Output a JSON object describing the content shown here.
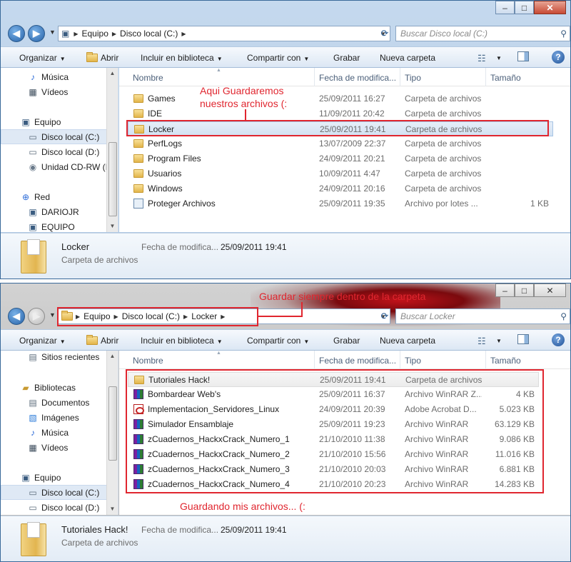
{
  "window1": {
    "controls": {
      "minimize": "–",
      "maximize": "□",
      "close": "✕"
    },
    "address": {
      "root_icon": "computer-icon",
      "segments": [
        "Equipo",
        "Disco local (C:)"
      ]
    },
    "search": {
      "placeholder": "Buscar Disco local (C:)"
    },
    "toolbar": {
      "organize": "Organizar",
      "open": "Abrir",
      "library": "Incluir en biblioteca",
      "share": "Compartir con",
      "burn": "Grabar",
      "new_folder": "Nueva carpeta"
    },
    "nav_items": [
      {
        "label": "Música",
        "icon": "music-icon"
      },
      {
        "label": "Vídeos",
        "icon": "video-icon"
      },
      {
        "label": "Equipo",
        "icon": "computer-icon"
      },
      {
        "label": "Disco local (C:)",
        "icon": "drive-icon",
        "selected": true
      },
      {
        "label": "Disco local (D:)",
        "icon": "drive-icon"
      },
      {
        "label": "Unidad CD-RW (I",
        "icon": "cd-icon"
      },
      {
        "label": "Red",
        "icon": "network-icon"
      },
      {
        "label": "DARIOJR",
        "icon": "computer-icon"
      },
      {
        "label": "EQUIPO",
        "icon": "computer-icon"
      }
    ],
    "columns": {
      "name": "Nombre",
      "date": "Fecha de modifica...",
      "type": "Tipo",
      "size": "Tamaño"
    },
    "files": [
      {
        "name": "Games",
        "date": "25/09/2011 16:27",
        "type": "Carpeta de archivos",
        "size": "",
        "icon": "folder"
      },
      {
        "name": "IDE",
        "date": "11/09/2011 20:42",
        "type": "Carpeta de archivos",
        "size": "",
        "icon": "folder"
      },
      {
        "name": "Locker",
        "date": "25/09/2011 19:41",
        "type": "Carpeta de archivos",
        "size": "",
        "icon": "folder",
        "highlighted": true
      },
      {
        "name": "PerfLogs",
        "date": "13/07/2009 22:37",
        "type": "Carpeta de archivos",
        "size": "",
        "icon": "folder"
      },
      {
        "name": "Program Files",
        "date": "24/09/2011 20:21",
        "type": "Carpeta de archivos",
        "size": "",
        "icon": "folder"
      },
      {
        "name": "Usuarios",
        "date": "10/09/2011 4:47",
        "type": "Carpeta de archivos",
        "size": "",
        "icon": "folder"
      },
      {
        "name": "Windows",
        "date": "24/09/2011 20:16",
        "type": "Carpeta de archivos",
        "size": "",
        "icon": "folder"
      },
      {
        "name": "Proteger Archivos",
        "date": "25/09/2011 19:35",
        "type": "Archivo por lotes ...",
        "size": "1 KB",
        "icon": "exe"
      }
    ],
    "details": {
      "name": "Locker",
      "type": "Carpeta de archivos",
      "date_label": "Fecha de modifica...",
      "date_value": "25/09/2011 19:41"
    },
    "annotation": "Aqui Guardaremos nuestros archivos (:"
  },
  "window2": {
    "controls": {
      "minimize": "–",
      "maximize": "□",
      "close": "✕"
    },
    "address": {
      "root_icon": "folder-icon",
      "segments": [
        "Equipo",
        "Disco local (C:)",
        "Locker"
      ]
    },
    "search": {
      "placeholder": "Buscar Locker"
    },
    "toolbar": {
      "organize": "Organizar",
      "open": "Abrir",
      "library": "Incluir en biblioteca",
      "share": "Compartir con",
      "burn": "Grabar",
      "new_folder": "Nueva carpeta"
    },
    "nav_items": [
      {
        "label": "Sitios recientes",
        "icon": "recent-icon"
      },
      {
        "label": "Bibliotecas",
        "icon": "library-icon"
      },
      {
        "label": "Documentos",
        "icon": "document-icon"
      },
      {
        "label": "Imágenes",
        "icon": "image-icon"
      },
      {
        "label": "Música",
        "icon": "music-icon"
      },
      {
        "label": "Vídeos",
        "icon": "video-icon"
      },
      {
        "label": "Equipo",
        "icon": "computer-icon"
      },
      {
        "label": "Disco local (C:)",
        "icon": "drive-icon",
        "selected": true
      },
      {
        "label": "Disco local (D:)",
        "icon": "drive-icon"
      }
    ],
    "columns": {
      "name": "Nombre",
      "date": "Fecha de modifica...",
      "type": "Tipo",
      "size": "Tamaño"
    },
    "files": [
      {
        "name": "Tutoriales Hack!",
        "date": "25/09/2011 19:41",
        "type": "Carpeta de archivos",
        "size": "",
        "icon": "folder",
        "highlighted": true
      },
      {
        "name": "Bombardear Web's",
        "date": "25/09/2011 16:37",
        "type": "Archivo WinRAR Z...",
        "size": "4 KB",
        "icon": "rar"
      },
      {
        "name": "Implementacion_Servidores_Linux",
        "date": "24/09/2011 20:39",
        "type": "Adobe Acrobat D...",
        "size": "5.023 KB",
        "icon": "pdf"
      },
      {
        "name": "Simulador Ensamblaje",
        "date": "25/09/2011 19:23",
        "type": "Archivo WinRAR",
        "size": "63.129 KB",
        "icon": "rar"
      },
      {
        "name": "zCuadernos_HackxCrack_Numero_1",
        "date": "21/10/2010 11:38",
        "type": "Archivo WinRAR",
        "size": "9.086 KB",
        "icon": "rar"
      },
      {
        "name": "zCuadernos_HackxCrack_Numero_2",
        "date": "21/10/2010 15:56",
        "type": "Archivo WinRAR",
        "size": "11.016 KB",
        "icon": "rar"
      },
      {
        "name": "zCuadernos_HackxCrack_Numero_3",
        "date": "21/10/2010 20:03",
        "type": "Archivo WinRAR",
        "size": "6.881 KB",
        "icon": "rar"
      },
      {
        "name": "zCuadernos_HackxCrack_Numero_4",
        "date": "21/10/2010 20:23",
        "type": "Archivo WinRAR",
        "size": "14.283 KB",
        "icon": "rar"
      }
    ],
    "details": {
      "name": "Tutoriales Hack!",
      "type": "Carpeta de archivos",
      "date_label": "Fecha de modifica...",
      "date_value": "25/09/2011 19:41"
    },
    "annotation_top": "Guardar siempre dentro de la carpeta",
    "annotation_bottom": "Guardando mis archivos... (:"
  },
  "colors": {
    "annotation_red": "#e0262f",
    "selection": "#dfe9f5"
  }
}
